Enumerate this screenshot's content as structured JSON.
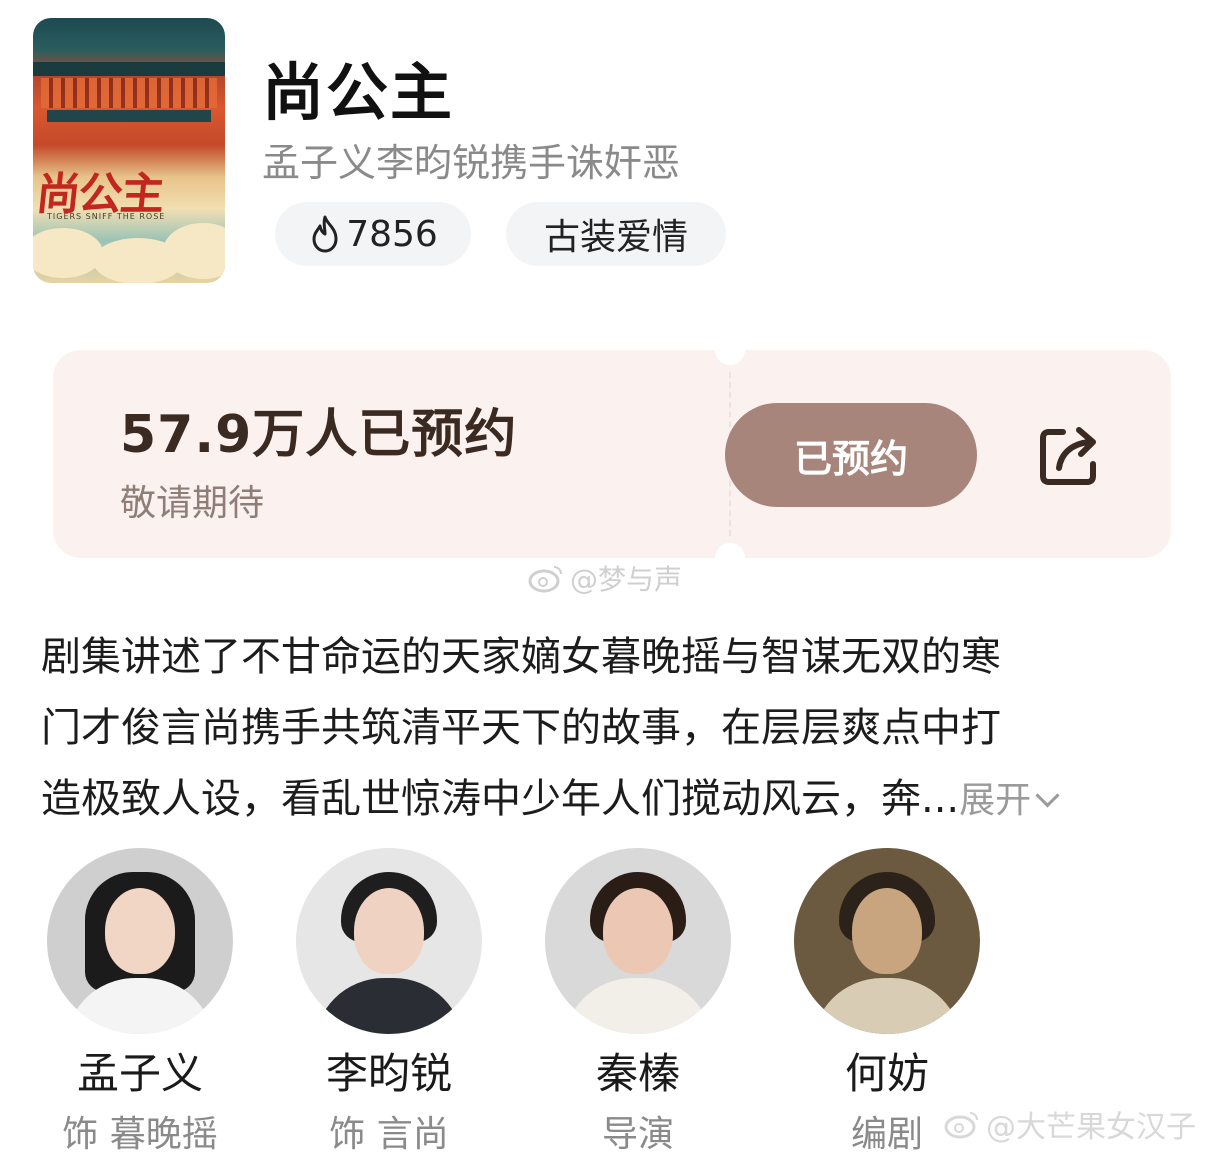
{
  "show": {
    "title": "尚公主",
    "subtitle": "孟子义李昀锐携手诛奸恶",
    "heat": "7856",
    "genre": "古装爱情",
    "poster": {
      "title_art": "尚公主",
      "english_title": "TIGERS SNIFF THE ROSE"
    }
  },
  "reservation": {
    "count_text": "57.9万人已预约",
    "hint": "敬请期待",
    "button_label": "已预约"
  },
  "watermarks": {
    "top": "@梦与声",
    "bottom": "@大芒果女汉子"
  },
  "description": {
    "lines": [
      "剧集讲述了不甘命运的天家嫡女暮晚摇与智谋无双的寒",
      "门才俊言尚携手共筑清平天下的故事，在层层爽点中打",
      "造极致人设，看乱世惊涛中少年人们搅动风云，奔..."
    ],
    "expand_label": "展开"
  },
  "cast": [
    {
      "name": "孟子义",
      "role": "饰 暮晚摇"
    },
    {
      "name": "李昀锐",
      "role": "饰 言尚"
    },
    {
      "name": "秦榛",
      "role": "导演"
    },
    {
      "name": "何妨",
      "role": "编剧"
    }
  ],
  "icons": [
    "flame-icon",
    "share-icon",
    "chevron-down-icon",
    "weibo-icon"
  ],
  "colors": {
    "card_bg": "#fbf1ee",
    "button_bg": "#a7857b",
    "count_text": "#3b2a22"
  }
}
